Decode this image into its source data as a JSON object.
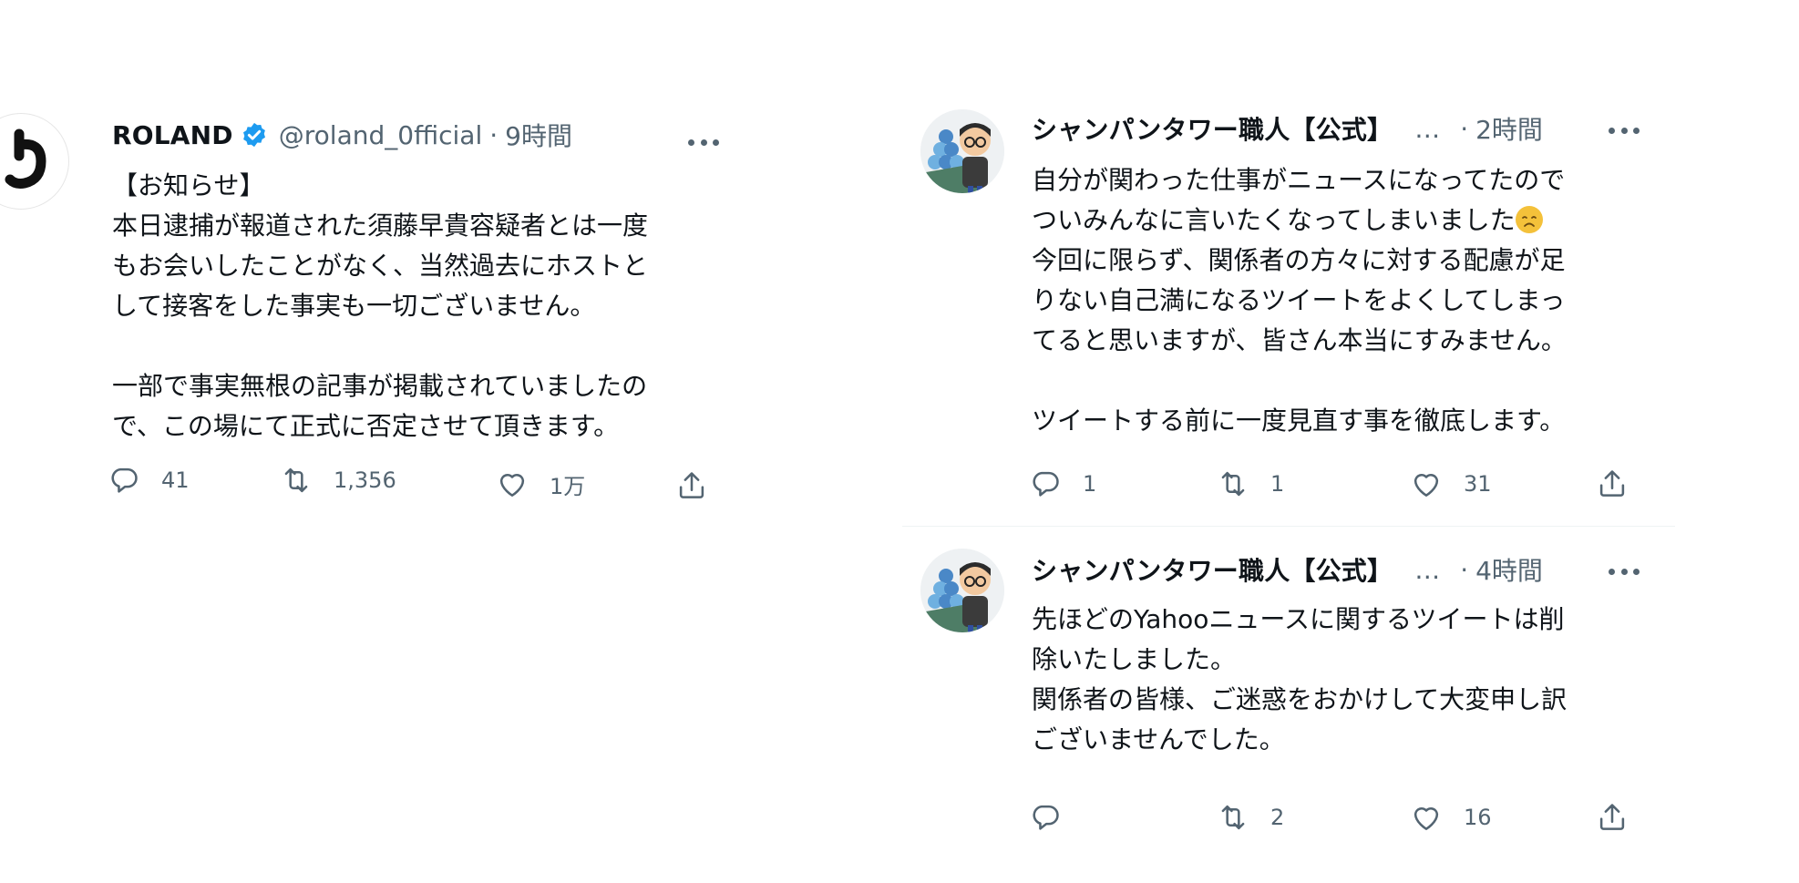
{
  "tweets": [
    {
      "name": "ROLAND",
      "verified": true,
      "handle": "@roland_0fficial",
      "separator": "·",
      "time": "9時間",
      "lines": [
        "【お知らせ】",
        "本日逮捕が報道された須藤早貴容疑者とは一度",
        "もお会いしたことがなく、当然過去にホストと",
        "して接客をした事実も一切ございません。",
        "",
        "一部で事実無根の記事が掲載されていましたの",
        "で、この場にて正式に否定させて頂きます。"
      ],
      "stats": {
        "reply": "41",
        "retweet": "1,356",
        "like": "1万"
      }
    },
    {
      "name": "シャンパンタワー職人【公式】",
      "ellipsis": "…",
      "separator": "·",
      "time": "2時間",
      "lines": [
        "自分が関わった仕事がニュースになってたので",
        "ついみんなに言いたくなってしまいました",
        "今回に限らず、関係者の方々に対する配慮が足",
        "りない自己満になるツイートをよくしてしまっ",
        "てると思いますが、皆さん本当にすみません。",
        "",
        "ツイートする前に一度見直す事を徹底します。"
      ],
      "emoji": "disappointed-face",
      "stats": {
        "reply": "1",
        "retweet": "1",
        "like": "31"
      }
    },
    {
      "name": "シャンパンタワー職人【公式】",
      "ellipsis": "…",
      "separator": "·",
      "time": "4時間",
      "lines": [
        "先ほどのYahooニュースに関するツイートは削",
        "除いたしました。",
        "関係者の皆様、ご迷惑をおかけして大変申し訳",
        "ございませんでした。"
      ],
      "stats": {
        "reply": "",
        "retweet": "2",
        "like": "16"
      }
    }
  ],
  "colors": {
    "text": "#0f1419",
    "secondary": "#536471",
    "verified": "#1d9bf0",
    "divider": "#eff3f4"
  }
}
